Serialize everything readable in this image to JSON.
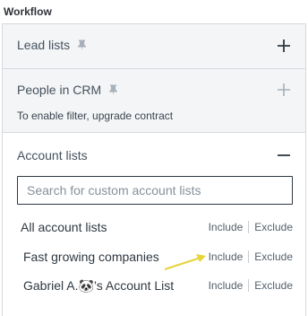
{
  "workflow": {
    "title": "Workflow"
  },
  "sections": {
    "lead_lists": {
      "label": "Lead lists",
      "pin_icon": "pin-icon",
      "toggle_icon": "plus-icon"
    },
    "people_in_crm": {
      "label": "People in CRM",
      "pin_icon": "pin-icon",
      "toggle_icon": "plus-icon",
      "note": "To enable filter, upgrade contract"
    },
    "account_lists": {
      "label": "Account lists",
      "toggle_icon": "minus-icon",
      "search": {
        "placeholder": "Search for custom account lists",
        "value": ""
      },
      "items": [
        {
          "label": "All account lists",
          "include": "Include",
          "exclude": "Exclude"
        },
        {
          "label": "Fast growing companies",
          "include": "Include",
          "exclude": "Exclude"
        },
        {
          "label": "Gabriel A.🐼’s Account List",
          "include": "Include",
          "exclude": "Exclude"
        }
      ]
    }
  },
  "annotation": {
    "icon": "arrow-annotation-icon",
    "color": "#e6d43a"
  },
  "colors": {
    "panel_bg": "#f3f5f7",
    "border": "#d5d9de",
    "text": "#2f3840",
    "disabled_icon": "#a8b0b8"
  }
}
